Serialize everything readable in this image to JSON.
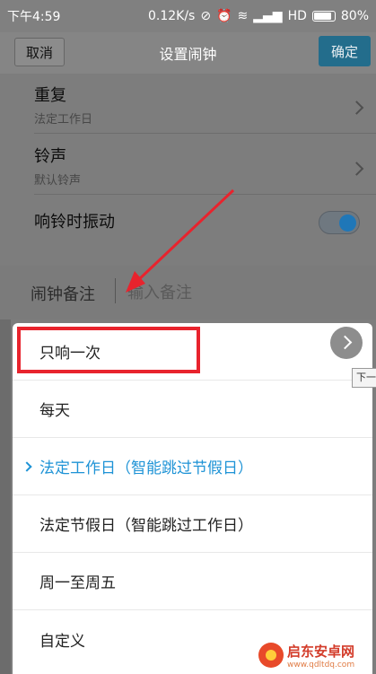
{
  "status_bar": {
    "time": "下午4:59",
    "speed": "0.12K/s",
    "network": "HD",
    "battery": "80%"
  },
  "header": {
    "cancel_label": "取消",
    "title": "设置闹钟",
    "confirm_label": "确定"
  },
  "settings": {
    "repeat": {
      "label": "重复",
      "value": "法定工作日"
    },
    "ringtone": {
      "label": "铃声",
      "value": "默认铃声"
    },
    "vibrate": {
      "label": "响铃时振动",
      "enabled": true
    }
  },
  "note": {
    "label": "闹钟备注",
    "placeholder": "输入备注"
  },
  "repeat_menu": {
    "options": [
      {
        "label": "只响一次",
        "selected": false
      },
      {
        "label": "每天",
        "selected": false
      },
      {
        "label": "法定工作日（智能跳过节假日）",
        "selected": true
      },
      {
        "label": "法定节假日（智能跳过工作日）",
        "selected": false
      },
      {
        "label": "周一至周五",
        "selected": false
      },
      {
        "label": "自定义",
        "selected": false
      }
    ]
  },
  "tooltip": "下一",
  "watermark": {
    "name": "启东安卓网",
    "url": "www.qdltdq.com"
  },
  "colors": {
    "accent": "#1e93d6",
    "highlight": "#e8232d"
  }
}
